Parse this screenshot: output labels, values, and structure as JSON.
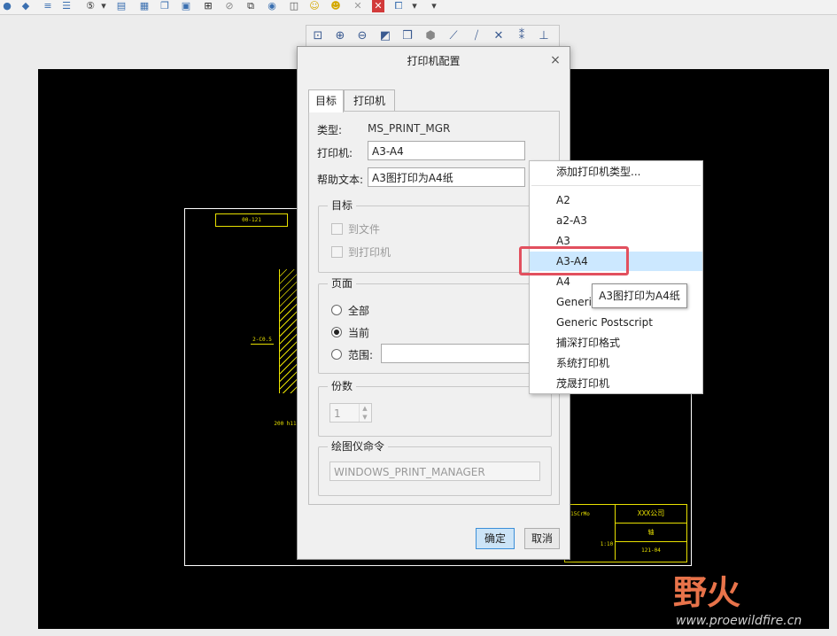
{
  "dialog": {
    "title": "打印机配置",
    "close": "×",
    "tabs": [
      "目标",
      "打印机"
    ],
    "type_label": "类型:",
    "type_value": "MS_PRINT_MGR",
    "printer_label": "打印机:",
    "printer_value": "A3-A4",
    "help_label": "帮助文本:",
    "help_value": "A3图打印为A4纸",
    "target_group": {
      "title": "目标",
      "to_file": "到文件",
      "to_printer": "到打印机"
    },
    "page_group": {
      "title": "页面",
      "all": "全部",
      "current": "当前",
      "range": "范围:",
      "selected": "current"
    },
    "copies_group": {
      "title": "份数",
      "value": "1"
    },
    "plotter_group": {
      "title": "绘图仪命令",
      "value": "WINDOWS_PRINT_MANAGER"
    },
    "ok": "确定",
    "cancel": "取消"
  },
  "dropdown": {
    "button_icon": "add-printer-icon",
    "items": [
      "添加打印机类型...",
      "A2",
      "a2-A3",
      "A3",
      "A3-A4",
      "A4",
      "Generic",
      "Generic Postscript",
      "捕深打印格式",
      "系统打印机",
      "茂晟打印机"
    ],
    "selected": "A3-A4"
  },
  "tooltip": "A3图打印为A4纸",
  "drawing": {
    "title_box": "00-121",
    "dim_label": "2-C0.5",
    "bottom_label": "200 h11",
    "tb_material": "15CrMo",
    "tb_company": "XXX公司",
    "tb_name": "轴",
    "tb_code": "121-04",
    "tb_scale": "1:10"
  },
  "watermark": {
    "logo": "野火",
    "url": "www.proewildfire.cn"
  },
  "colors": {
    "accent": "#3c8fd8",
    "highlight": "#e2505e",
    "drawing_line": "#e8e000"
  }
}
